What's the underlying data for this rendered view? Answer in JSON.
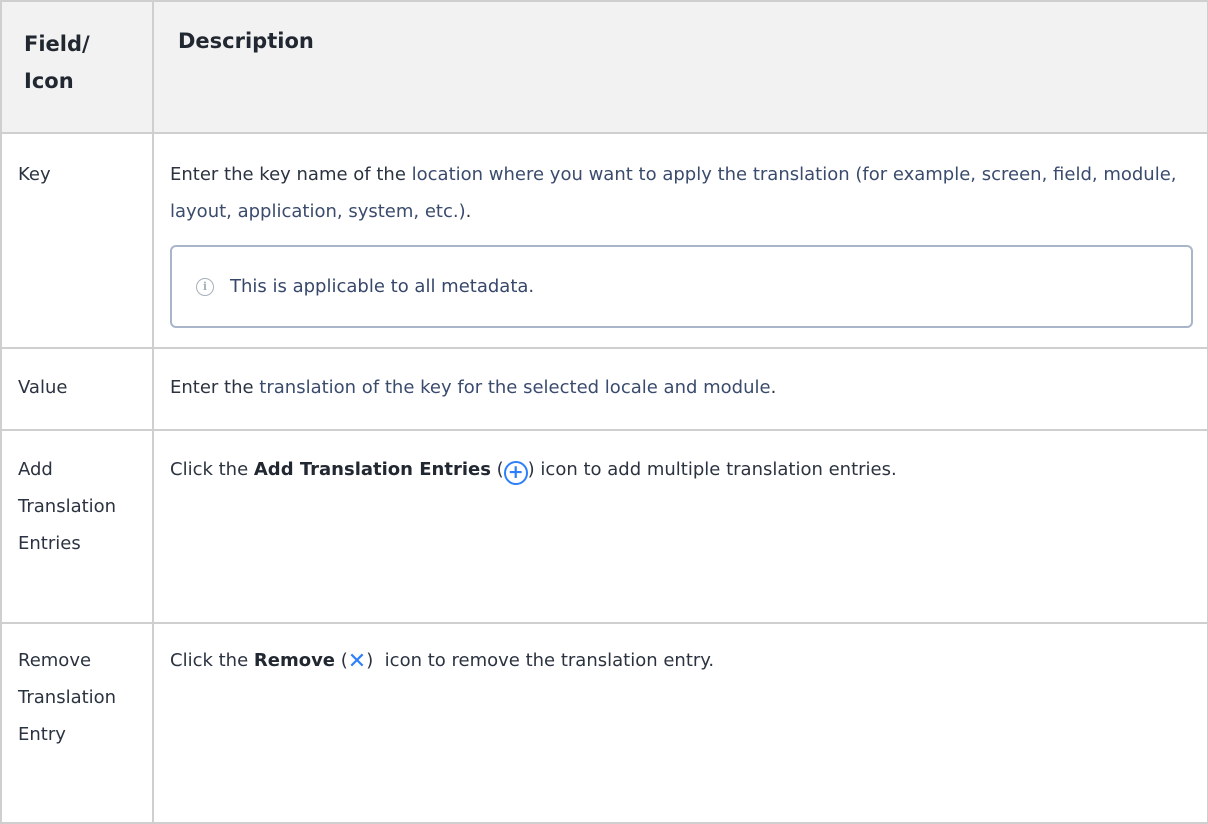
{
  "header": {
    "col1": "Field/ Icon",
    "col2": "Description"
  },
  "rows": [
    {
      "field": "Key",
      "text_before": "Enter the key name of the ",
      "link": "location where you want to apply the translation (for example, screen, field, module, layout, application, system, etc.)",
      "text_after": ".",
      "note": "This is applicable to all metadata."
    },
    {
      "field": "Value",
      "text_before": "Enter the ",
      "link": "translation of the key for the selected locale and module",
      "text_after": "."
    },
    {
      "field": "Add Translation Entries",
      "text_before": "Click the ",
      "bold": "Add Translation Entries",
      "paren_open": " (",
      "icon": "add-circle-icon",
      "paren_close": ")",
      "text_after": " icon to add multiple translation entries."
    },
    {
      "field": "Remove Translation Entry",
      "text_before": "Click the ",
      "bold": "Remove",
      "paren_open": " (",
      "icon": "remove-x-icon",
      "paren_close": ")",
      "text_after": "  icon to remove the translation entry."
    }
  ],
  "colors": {
    "icon_blue": "#2d7ff9",
    "border": "#cfcfcf",
    "header_bg": "#f2f2f2",
    "link": "#3a4b6d"
  }
}
